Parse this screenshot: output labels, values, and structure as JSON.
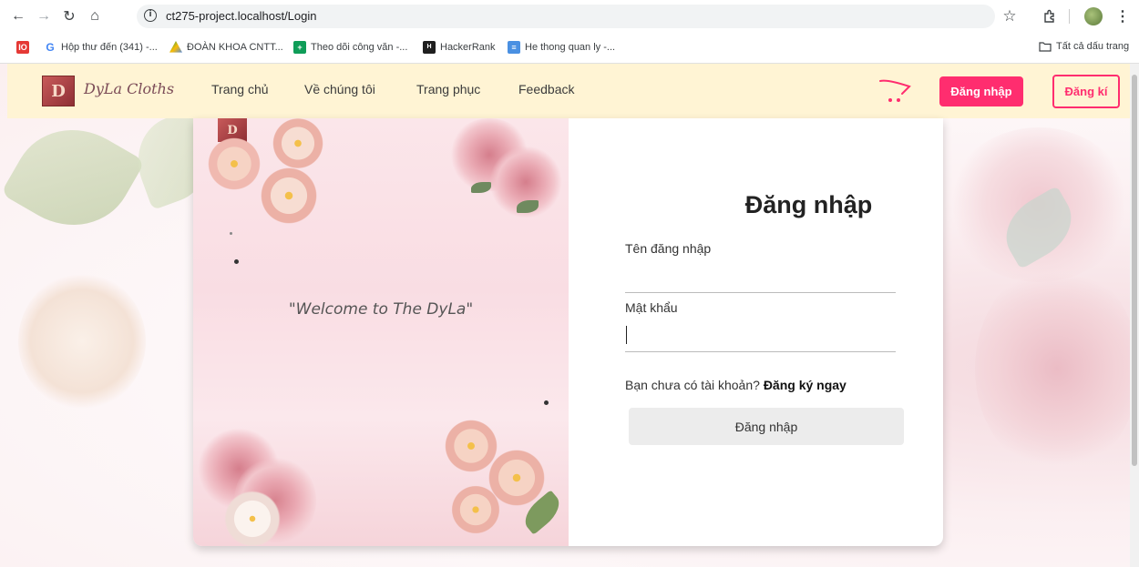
{
  "browser": {
    "url": "ct275-project.localhost/Login",
    "bookmarks": [
      {
        "label": "Hộp thư đến (341) -...",
        "icon": "gmail-icon",
        "color": "#1a73e8"
      },
      {
        "label": "ĐOÀN KHOA CNTT...",
        "icon": "drive-icon",
        "color": "#fbbc04"
      },
      {
        "label": "Theo dõi công văn -...",
        "icon": "sheets-icon",
        "color": "#0f9d58"
      },
      {
        "label": "HackerRank",
        "icon": "hackerrank-icon",
        "color": "#1f1f1f"
      },
      {
        "label": "He thong quan ly -...",
        "icon": "app-icon",
        "color": "#4a90e2"
      }
    ],
    "all_bookmarks": "Tất cả dấu trang"
  },
  "navbar": {
    "brand_mark": "D",
    "brand_script": "DyLa Cloths",
    "links": [
      "Trang chủ",
      "Về chúng tôi",
      "Trang phục",
      "Feedback"
    ],
    "login_label": "Đăng nhập",
    "register_label": "Đăng kí",
    "accent": "#ff2d6f",
    "bar_color": "#fff4d4"
  },
  "card": {
    "welcome": "\"Welcome to The DyLa\"",
    "brand_mark": "D",
    "title": "Đăng nhập",
    "username_label": "Tên đăng nhập",
    "username_value": "",
    "password_label": "Mật khẩu",
    "password_value": "",
    "signup_prompt": "Bạn chưa có tài khoản?",
    "signup_link": "Đăng ký ngay",
    "submit_label": "Đăng nhập"
  }
}
